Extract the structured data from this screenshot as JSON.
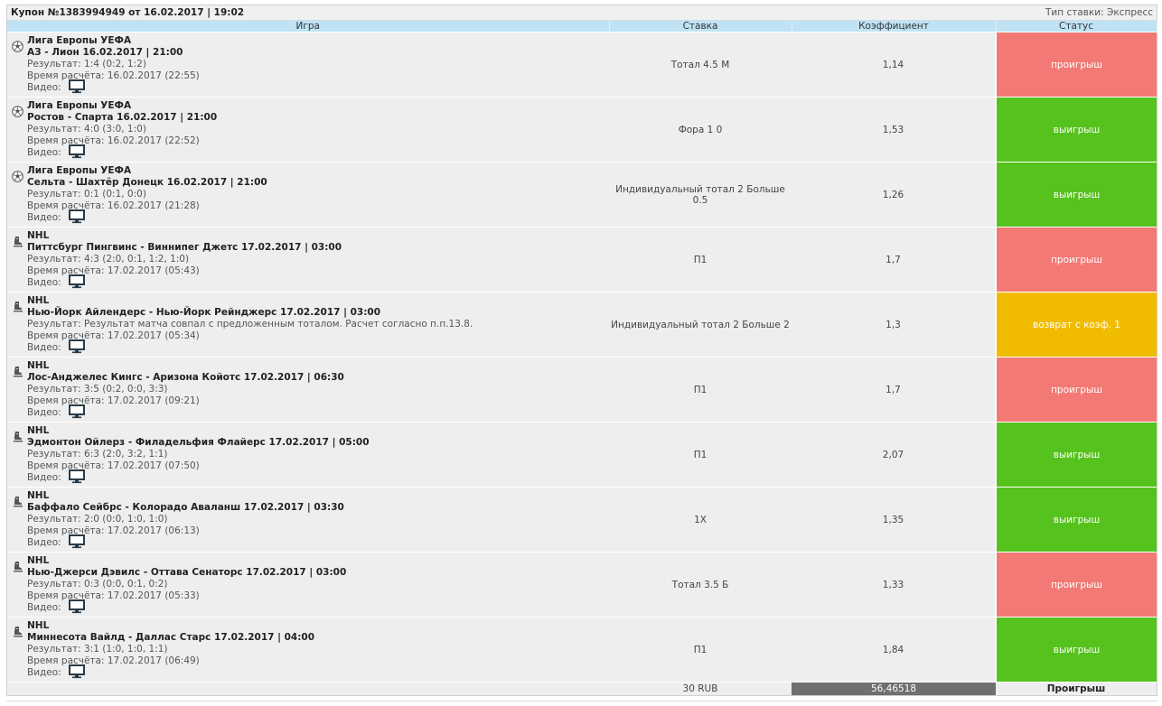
{
  "coupon": {
    "title": "Купон №1383994949 от 16.02.2017 | 19:02",
    "bet_type": "Тип ставки: Экспресс"
  },
  "headers": {
    "game": "Игра",
    "stake": "Ставка",
    "coef": "Коэффициент",
    "status": "Статус"
  },
  "video_label": "Видео:",
  "rows": [
    {
      "sport": "football",
      "league": "Лига Европы УЕФА",
      "match": "АЗ - Лион 16.02.2017 | 21:00",
      "result": "Результат: 1:4 (0:2, 1:2)",
      "calc_time": "Время расчёта: 16.02.2017 (22:55)",
      "bet": "Тотал 4.5 М",
      "coef": "1,14",
      "status": "проигрыш",
      "status_kind": "lose"
    },
    {
      "sport": "football",
      "league": "Лига Европы УЕФА",
      "match": "Ростов - Спарта 16.02.2017 | 21:00",
      "result": "Результат: 4:0 (3:0, 1:0)",
      "calc_time": "Время расчёта: 16.02.2017 (22:52)",
      "bet": "Фора 1 0",
      "coef": "1,53",
      "status": "выигрыш",
      "status_kind": "win"
    },
    {
      "sport": "football",
      "league": "Лига Европы УЕФА",
      "match": "Сельта - Шахтёр Донецк 16.02.2017 | 21:00",
      "result": "Результат: 0:1 (0:1, 0:0)",
      "calc_time": "Время расчёта: 16.02.2017 (21:28)",
      "bet": "Индивидуальный тотал 2 Больше 0.5",
      "coef": "1,26",
      "status": "выигрыш",
      "status_kind": "win"
    },
    {
      "sport": "hockey",
      "league": "NHL",
      "match": "Питтсбург Пингвинс - Виннипег Джетс 17.02.2017 | 03:00",
      "result": "Результат: 4:3 (2:0, 0:1, 1:2, 1:0)",
      "calc_time": "Время расчёта: 17.02.2017 (05:43)",
      "bet": "П1",
      "coef": "1,7",
      "status": "проигрыш",
      "status_kind": "lose"
    },
    {
      "sport": "hockey",
      "league": "NHL",
      "match": "Нью-Йорк Айлендерс - Нью-Йорк Рейнджерс 17.02.2017 | 03:00",
      "result": "Результат: Результат матча совпал с предложенным тоталом. Расчет согласно п.п.13.8.",
      "calc_time": "Время расчёта: 17.02.2017 (05:34)",
      "bet": "Индивидуальный тотал 2 Больше 2",
      "coef": "1,3",
      "status": "возврат с коэф. 1",
      "status_kind": "refund"
    },
    {
      "sport": "hockey",
      "league": "NHL",
      "match": "Лос-Анджелес Кингс - Аризона Койотс 17.02.2017 | 06:30",
      "result": "Результат: 3:5 (0:2, 0:0, 3:3)",
      "calc_time": "Время расчёта: 17.02.2017 (09:21)",
      "bet": "П1",
      "coef": "1,7",
      "status": "проигрыш",
      "status_kind": "lose"
    },
    {
      "sport": "hockey",
      "league": "NHL",
      "match": "Эдмонтон Ойлерз - Филадельфия Флайерс 17.02.2017 | 05:00",
      "result": "Результат: 6:3 (2:0, 3:2, 1:1)",
      "calc_time": "Время расчёта: 17.02.2017 (07:50)",
      "bet": "П1",
      "coef": "2,07",
      "status": "выигрыш",
      "status_kind": "win"
    },
    {
      "sport": "hockey",
      "league": "NHL",
      "match": "Баффало Сейбрс - Колорадо Аваланш 17.02.2017 | 03:30",
      "result": "Результат: 2:0 (0:0, 1:0, 1:0)",
      "calc_time": "Время расчёта: 17.02.2017 (06:13)",
      "bet": "1X",
      "coef": "1,35",
      "status": "выигрыш",
      "status_kind": "win"
    },
    {
      "sport": "hockey",
      "league": "NHL",
      "match": "Нью-Джерси Дэвилс - Оттава Сенаторс 17.02.2017 | 03:00",
      "result": "Результат: 0:3 (0:0, 0:1, 0:2)",
      "calc_time": "Время расчёта: 17.02.2017 (05:33)",
      "bet": "Тотал 3.5 Б",
      "coef": "1,33",
      "status": "проигрыш",
      "status_kind": "lose"
    },
    {
      "sport": "hockey",
      "league": "NHL",
      "match": "Миннесота Вайлд - Даллас Старс 17.02.2017 | 04:00",
      "result": "Результат: 3:1 (1:0, 1:0, 1:1)",
      "calc_time": "Время расчёта: 17.02.2017 (06:49)",
      "bet": "П1",
      "coef": "1,84",
      "status": "выигрыш",
      "status_kind": "win"
    }
  ],
  "totals": {
    "stake": "30 RUB",
    "coef": "56,46518",
    "status": "Проигрыш"
  },
  "colors": {
    "lose": "#f37a74",
    "win": "#56c21d",
    "refund": "#f1bc00",
    "header_bg": "#bfe3f5"
  },
  "icons": {
    "football": "soccer-ball-icon",
    "hockey": "hockey-skate-icon",
    "video": "monitor-icon"
  }
}
